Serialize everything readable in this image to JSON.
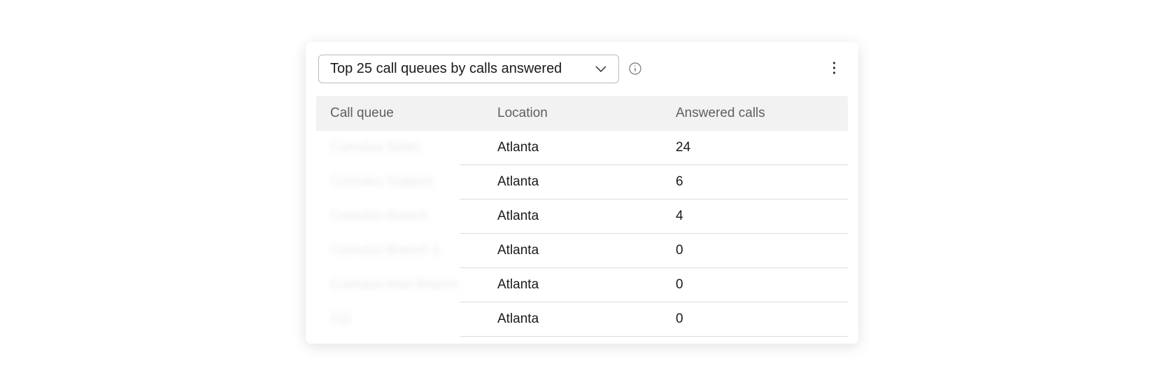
{
  "header": {
    "dropdown_label": "Top 25 call queues by calls answered"
  },
  "table": {
    "columns": {
      "queue": "Call queue",
      "location": "Location",
      "answered": "Answered calls"
    },
    "rows": [
      {
        "queue": "Cumulus Sales",
        "location": "Atlanta",
        "answered": "24"
      },
      {
        "queue": "Cumulus Support",
        "location": "Atlanta",
        "answered": "6"
      },
      {
        "queue": "Cumulus Branch",
        "location": "Atlanta",
        "answered": "4"
      },
      {
        "queue": "Cumulus Branch 2",
        "location": "Atlanta",
        "answered": "0"
      },
      {
        "queue": "Cumulus New Branch",
        "location": "Atlanta",
        "answered": "0"
      },
      {
        "queue": "CQ",
        "location": "Atlanta",
        "answered": "0"
      }
    ]
  }
}
